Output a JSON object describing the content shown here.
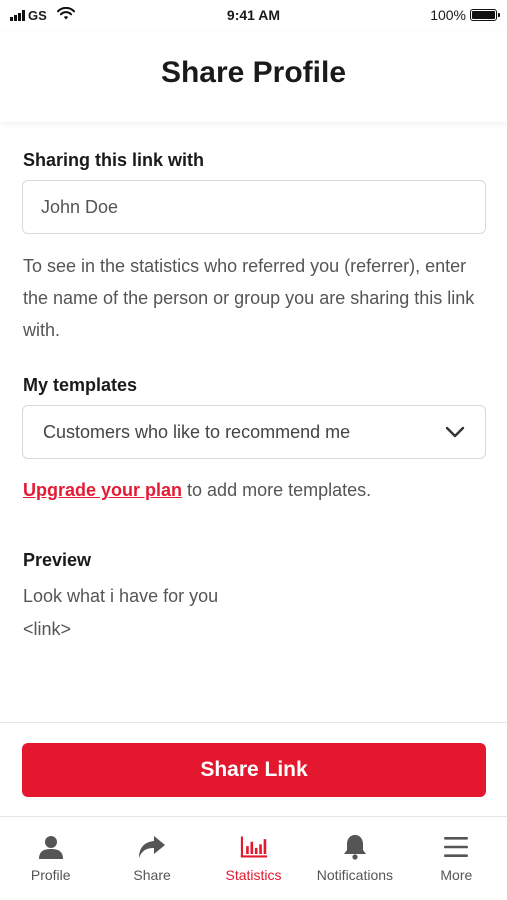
{
  "status_bar": {
    "carrier": "GS",
    "time": "9:41 AM",
    "battery": "100%"
  },
  "header": {
    "title": "Share Profile"
  },
  "form": {
    "sharing_label": "Sharing this link with",
    "sharing_value": "John Doe",
    "help_text": "To see in the statistics who referred you (referrer), enter the name of the person or group you are sharing this link with.",
    "templates_label": "My templates",
    "template_selected": "Customers who like to recommend me",
    "upgrade_link": "Upgrade your plan",
    "upgrade_suffix": " to add more templates.",
    "preview_label": "Preview",
    "preview_line1": "Look what i have for you",
    "preview_line2": "<link>"
  },
  "actions": {
    "share_label": "Share Link"
  },
  "tabbar": {
    "items": [
      {
        "label": "Profile",
        "icon": "person-icon",
        "active": false
      },
      {
        "label": "Share",
        "icon": "share-arrow-icon",
        "active": false
      },
      {
        "label": "Statistics",
        "icon": "bar-chart-icon",
        "active": true
      },
      {
        "label": "Notifications",
        "icon": "bell-icon",
        "active": false
      },
      {
        "label": "More",
        "icon": "menu-icon",
        "active": false
      }
    ]
  },
  "colors": {
    "accent": "#e3182f",
    "text": "#1a1a1a",
    "muted": "#555555"
  }
}
